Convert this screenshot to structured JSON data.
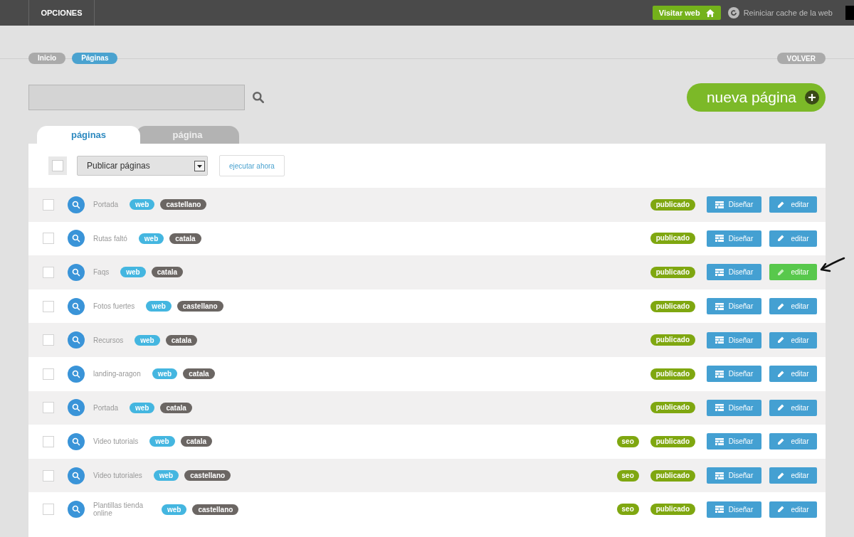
{
  "topbar": {
    "menu": "OPCIONES",
    "visit_button": "Visitar web",
    "cache_link": "Reiniciar cache de la web"
  },
  "breadcrumbs": [
    {
      "label": "Inicio",
      "selected": false
    },
    {
      "label": "Páginas",
      "selected": true
    }
  ],
  "back_button": "VOLVER",
  "new_page_button": "nueva página",
  "tabs": [
    {
      "label": "páginas",
      "selected": true
    },
    {
      "label": "página",
      "selected": false
    }
  ],
  "bulk": {
    "checked": false,
    "action": "Publicar páginas",
    "run_button": "ejecutar ahora"
  },
  "rows": [
    {
      "name": "Portada",
      "checked": false,
      "tags": [
        "web",
        "castellano"
      ],
      "seo": false,
      "status": "publicado",
      "design": "Diseñar",
      "edit": "editar",
      "highlighted": false
    },
    {
      "name": "Rutas faltó",
      "checked": false,
      "tags": [
        "web",
        "catala"
      ],
      "seo": false,
      "status": "publicado",
      "design": "Diseñar",
      "edit": "editar",
      "highlighted": false
    },
    {
      "name": "Faqs",
      "checked": false,
      "tags": [
        "web",
        "catala"
      ],
      "seo": false,
      "status": "publicado",
      "design": "Diseñar",
      "edit": "editar",
      "highlighted": true
    },
    {
      "name": "Fotos fuertes",
      "checked": false,
      "tags": [
        "web",
        "castellano"
      ],
      "seo": false,
      "status": "publicado",
      "design": "Diseñar",
      "edit": "editar",
      "highlighted": false
    },
    {
      "name": "Recursos",
      "checked": false,
      "tags": [
        "web",
        "catala"
      ],
      "seo": false,
      "status": "publicado",
      "design": "Diseñar",
      "edit": "editar",
      "highlighted": false
    },
    {
      "name": "landing-aragon",
      "checked": false,
      "tags": [
        "web",
        "catala"
      ],
      "seo": false,
      "status": "publicado",
      "design": "Diseñar",
      "edit": "editar",
      "highlighted": false
    },
    {
      "name": "Portada",
      "checked": false,
      "tags": [
        "web",
        "catala"
      ],
      "seo": false,
      "status": "publicado",
      "design": "Diseñar",
      "edit": "editar",
      "highlighted": false
    },
    {
      "name": "Video tutorials",
      "checked": false,
      "tags": [
        "web",
        "catala"
      ],
      "seo": true,
      "seo_label": "seo",
      "status": "publicado",
      "design": "Diseñar",
      "edit": "editar",
      "highlighted": false
    },
    {
      "name": "Video tutoriales",
      "checked": false,
      "tags": [
        "web",
        "castellano"
      ],
      "seo": true,
      "seo_label": "seo",
      "status": "publicado",
      "design": "Diseñar",
      "edit": "editar",
      "highlighted": false
    },
    {
      "name": "Plantillas tienda online",
      "checked": false,
      "tags": [
        "web",
        "castellano"
      ],
      "seo": true,
      "seo_label": "seo",
      "status": "publicado",
      "design": "Diseñar",
      "edit": "editar",
      "highlighted": false
    }
  ]
}
